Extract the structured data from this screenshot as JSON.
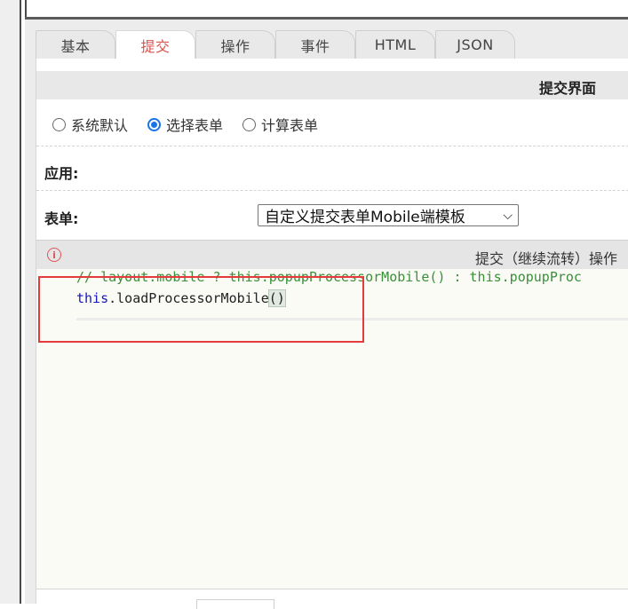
{
  "tabs": [
    {
      "label": "基本",
      "active": false
    },
    {
      "label": "提交",
      "active": true
    },
    {
      "label": "操作",
      "active": false
    },
    {
      "label": "事件",
      "active": false
    },
    {
      "label": "HTML",
      "active": false
    },
    {
      "label": "JSON",
      "active": false
    }
  ],
  "section_title": "提交界面",
  "radio_options": [
    {
      "label": "系统默认",
      "checked": false
    },
    {
      "label": "选择表单",
      "checked": true
    },
    {
      "label": "计算表单",
      "checked": false
    }
  ],
  "fields": {
    "apply_label": "应用:",
    "form_label": "表单:",
    "form_select_value": "自定义提交表单Mobile端模板"
  },
  "code_panel": {
    "title": "提交（继续流转）操作",
    "info_icon": "info-icon",
    "lines": {
      "line1_comment": "// layout.mobile ? this.popupProcessorMobile() : this.popupProc",
      "line2_kw": "this",
      "line2_rest": ".loadProcessorMobile",
      "line2_parens": "()"
    }
  },
  "colors": {
    "active_tab": "#d9534f",
    "radio_checked": "#1a73e8",
    "comment": "#3a8f3a",
    "keyword": "#1515c4",
    "highlight_box": "#e33b3b"
  }
}
